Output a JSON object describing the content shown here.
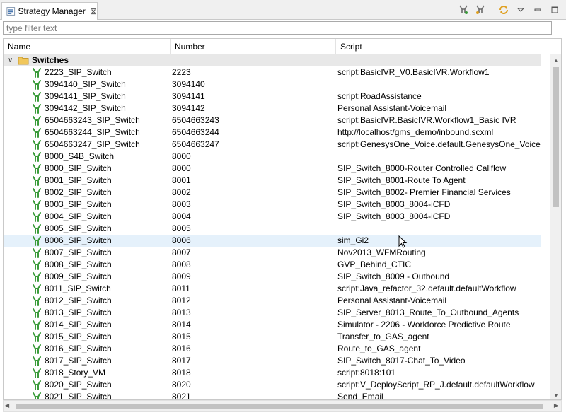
{
  "tab": {
    "title": "Strategy Manager",
    "close": "⊠"
  },
  "filter": {
    "placeholder": "type filter text",
    "value": ""
  },
  "columns": {
    "name": "Name",
    "number": "Number",
    "script": "Script"
  },
  "group": {
    "label": "Switches"
  },
  "colors": {
    "switch_icon": "#3a9b3a",
    "folder": "#f1c75b",
    "selected_row": "#e5f1fb",
    "group_row": "#e8e8e8"
  },
  "rows": [
    {
      "name": "2223_SIP_Switch",
      "number": "2223",
      "script": "script:BasicIVR_V0.BasicIVR.Workflow1"
    },
    {
      "name": "3094140_SIP_Switch",
      "number": "3094140",
      "script": ""
    },
    {
      "name": "3094141_SIP_Switch",
      "number": "3094141",
      "script": "script:RoadAssistance"
    },
    {
      "name": "3094142_SIP_Switch",
      "number": "3094142",
      "script": "Personal Assistant-Voicemail"
    },
    {
      "name": "6504663243_SIP_Switch",
      "number": "6504663243",
      "script": "script:BasicIVR.BasicIVR.Workflow1_Basic IVR"
    },
    {
      "name": "6504663244_SIP_Switch",
      "number": "6504663244",
      "script": "http://localhost/gms_demo/inbound.scxml"
    },
    {
      "name": "6504663247_SIP_Switch",
      "number": "6504663247",
      "script": "script:GenesysOne_Voice.default.GenesysOne_Voice"
    },
    {
      "name": "8000_S4B_Switch",
      "number": "8000",
      "script": ""
    },
    {
      "name": "8000_SIP_Switch",
      "number": "8000",
      "script": "SIP_Switch_8000-Router Controlled Callflow"
    },
    {
      "name": "8001_SIP_Switch",
      "number": "8001",
      "script": "SIP_Switch_8001-Route To Agent"
    },
    {
      "name": "8002_SIP_Switch",
      "number": "8002",
      "script": "SIP_Switch_8002- Premier Financial Services"
    },
    {
      "name": "8003_SIP_Switch",
      "number": "8003",
      "script": "SIP_Switch_8003_8004-iCFD"
    },
    {
      "name": "8004_SIP_Switch",
      "number": "8004",
      "script": "SIP_Switch_8003_8004-iCFD"
    },
    {
      "name": "8005_SIP_Switch",
      "number": "8005",
      "script": ""
    },
    {
      "name": "8006_SIP_Switch",
      "number": "8006",
      "script": "sim_Gi2",
      "selected": true
    },
    {
      "name": "8007_SIP_Switch",
      "number": "8007",
      "script": "Nov2013_WFMRouting"
    },
    {
      "name": "8008_SIP_Switch",
      "number": "8008",
      "script": "GVP_Behind_CTIC"
    },
    {
      "name": "8009_SIP_Switch",
      "number": "8009",
      "script": "SIP_Switch_8009 - Outbound"
    },
    {
      "name": "8011_SIP_Switch",
      "number": "8011",
      "script": "script:Java_refactor_32.default.defaultWorkflow"
    },
    {
      "name": "8012_SIP_Switch",
      "number": "8012",
      "script": "Personal Assistant-Voicemail"
    },
    {
      "name": "8013_SIP_Switch",
      "number": "8013",
      "script": "SIP_Server_8013_Route_To_Outbound_Agents"
    },
    {
      "name": "8014_SIP_Switch",
      "number": "8014",
      "script": "Simulator - 2206 - Workforce Predictive Route"
    },
    {
      "name": "8015_SIP_Switch",
      "number": "8015",
      "script": "Transfer_to_GAS_agent"
    },
    {
      "name": "8016_SIP_Switch",
      "number": "8016",
      "script": "Route_to_GAS_agent"
    },
    {
      "name": "8017_SIP_Switch",
      "number": "8017",
      "script": "SIP_Switch_8017-Chat_To_Video"
    },
    {
      "name": "8018_Story_VM",
      "number": "8018",
      "script": "script:8018:101"
    },
    {
      "name": "8020_SIP_Switch",
      "number": "8020",
      "script": "script:V_DeployScript_RP_J.default.defaultWorkflow"
    },
    {
      "name": "8021_SIP_Switch",
      "number": "8021",
      "script": "Send_Email"
    }
  ]
}
